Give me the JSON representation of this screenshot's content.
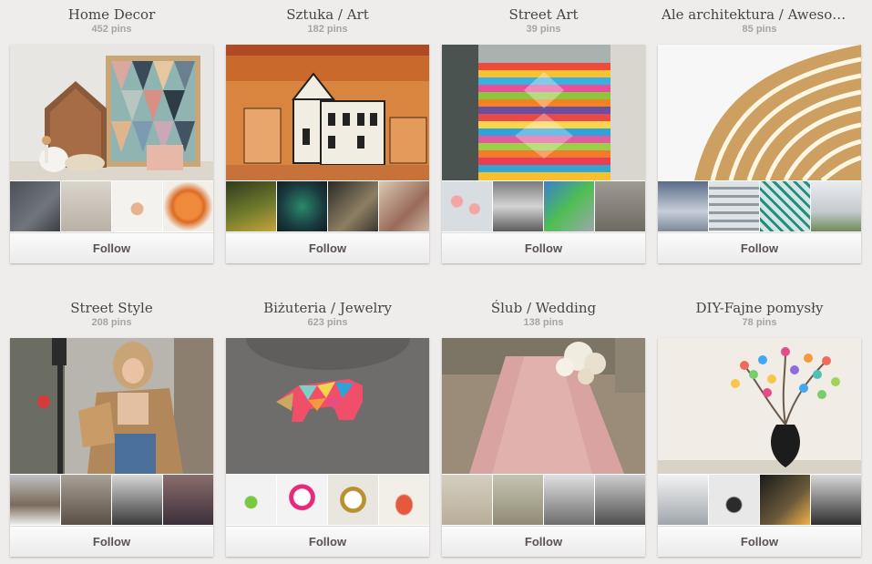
{
  "boards": [
    {
      "title": "Home Decor",
      "pins": "452 pins",
      "follow_label": "Follow",
      "cover_image": "home-decor-cover-image",
      "thumbnails": [
        "home-decor-thumb-1",
        "home-decor-thumb-2",
        "home-decor-thumb-3",
        "home-decor-thumb-4"
      ]
    },
    {
      "title": "Sztuka / Art",
      "pins": "182 pins",
      "follow_label": "Follow",
      "cover_image": "art-cover-image",
      "thumbnails": [
        "art-thumb-1",
        "art-thumb-2",
        "art-thumb-3",
        "art-thumb-4"
      ]
    },
    {
      "title": "Street Art",
      "pins": "39 pins",
      "follow_label": "Follow",
      "cover_image": "street-art-cover-image",
      "thumbnails": [
        "street-art-thumb-1",
        "street-art-thumb-2",
        "street-art-thumb-3",
        "street-art-thumb-4"
      ]
    },
    {
      "title": "Ale architektura / Awesome Architecture",
      "pins": "85 pins",
      "follow_label": "Follow",
      "cover_image": "architecture-cover-image",
      "thumbnails": [
        "architecture-thumb-1",
        "architecture-thumb-2",
        "architecture-thumb-3",
        "architecture-thumb-4"
      ]
    },
    {
      "title": "Street Style",
      "pins": "208 pins",
      "follow_label": "Follow",
      "cover_image": "street-style-cover-image",
      "thumbnails": [
        "street-style-thumb-1",
        "street-style-thumb-2",
        "street-style-thumb-3",
        "street-style-thumb-4"
      ]
    },
    {
      "title": "Biżuteria / Jewelry",
      "pins": "623 pins",
      "follow_label": "Follow",
      "cover_image": "jewelry-cover-image",
      "thumbnails": [
        "jewelry-thumb-1",
        "jewelry-thumb-2",
        "jewelry-thumb-3",
        "jewelry-thumb-4"
      ]
    },
    {
      "title": "Ślub / Wedding",
      "pins": "138 pins",
      "follow_label": "Follow",
      "cover_image": "wedding-cover-image",
      "thumbnails": [
        "wedding-thumb-1",
        "wedding-thumb-2",
        "wedding-thumb-3",
        "wedding-thumb-4"
      ]
    },
    {
      "title": "DIY-Fajne pomysły",
      "pins": "78 pins",
      "follow_label": "Follow",
      "cover_image": "diy-cover-image",
      "thumbnails": [
        "diy-thumb-1",
        "diy-thumb-2",
        "diy-thumb-3",
        "diy-thumb-4"
      ]
    }
  ],
  "colors": {
    "page_background": "#efedeb",
    "title_text": "#4a4242",
    "count_text": "#a9a3a0",
    "follow_text": "#5a5252"
  }
}
